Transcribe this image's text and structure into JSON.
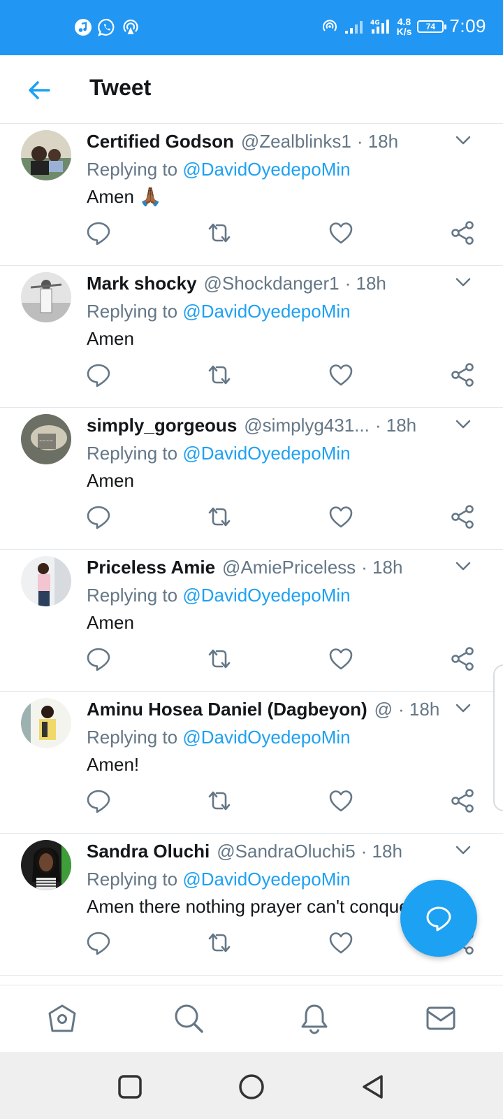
{
  "status_bar": {
    "speed_value": "4.8",
    "speed_unit": "K/s",
    "battery": "74",
    "time": "7:09",
    "left_icons": [
      "music-icon",
      "whatsapp-icon",
      "hotspot-icon"
    ],
    "right_icons": [
      "hotspot-icon",
      "signal-icon",
      "signal-4g-icon",
      "battery-icon"
    ]
  },
  "header": {
    "title": "Tweet"
  },
  "replying_prefix": "Replying to",
  "tweets": [
    {
      "name": "Certified Godson",
      "handle": "@Zealblinks1",
      "sep_time": "· 18h",
      "mention": "@DavidOyedepoMin",
      "text": "Amen 🙏🏾"
    },
    {
      "name": "Mark shocky",
      "handle": "@Shockdanger1",
      "sep_time": "· 18h",
      "mention": "@DavidOyedepoMin",
      "text": "Amen"
    },
    {
      "name": "simply_gorgeous",
      "handle": "@simplyg431...",
      "sep_time": "· 18h",
      "mention": "@DavidOyedepoMin",
      "text": "Amen"
    },
    {
      "name": "Priceless Amie",
      "handle": "@AmiePriceless",
      "sep_time": "· 18h",
      "mention": "@DavidOyedepoMin",
      "text": "Amen"
    },
    {
      "name": "Aminu Hosea Daniel (Dagbeyon)",
      "handle": "@",
      "sep_time": "· 18h",
      "mention": "@DavidOyedepoMin",
      "text": "Amen!"
    },
    {
      "name": "Sandra Oluchi",
      "handle": "@SandraOluchi5",
      "sep_time": "· 18h",
      "mention": "@DavidOyedepoMin",
      "text": "Amen there nothing prayer can't conquer"
    }
  ],
  "bottom_nav": [
    "home-icon",
    "search-icon",
    "notifications-icon",
    "messages-icon"
  ],
  "system_nav": [
    "recent-apps-icon",
    "home-circle-icon",
    "back-triangle-icon"
  ],
  "colors": {
    "status_bar": "#2196f3",
    "accent": "#1da1f2",
    "secondary_text": "#657786",
    "divider": "#e1e8ed"
  }
}
